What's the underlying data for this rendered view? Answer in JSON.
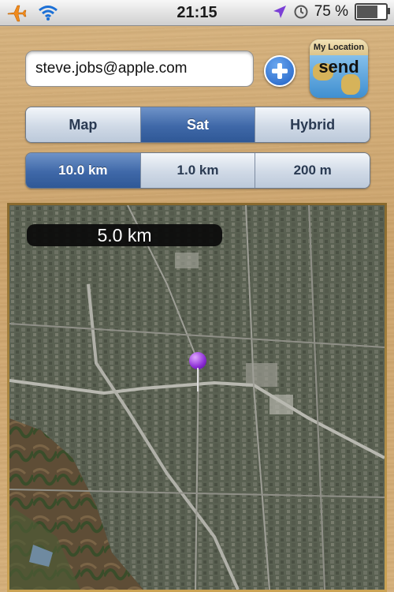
{
  "status_bar": {
    "time": "21:15",
    "battery_percent": "75 %",
    "battery_level": 0.75,
    "icons": [
      "airplane-icon",
      "wifi-icon",
      "location-arrow-icon",
      "clock-icon",
      "battery-icon"
    ]
  },
  "email": {
    "value": "steve.jobs@apple.com"
  },
  "send_button": {
    "top_label": "My Location",
    "label": "send"
  },
  "map_type": {
    "options": [
      "Map",
      "Sat",
      "Hybrid"
    ],
    "selected": "Sat"
  },
  "zoom": {
    "options": [
      "10.0 km",
      "1.0 km",
      "200 m"
    ],
    "selected": "10.0 km"
  },
  "map": {
    "scale_label": "5.0 km"
  },
  "colors": {
    "accent": "#3f68a8",
    "pin": "#8a2bd4",
    "wood": "#d2ab73"
  }
}
